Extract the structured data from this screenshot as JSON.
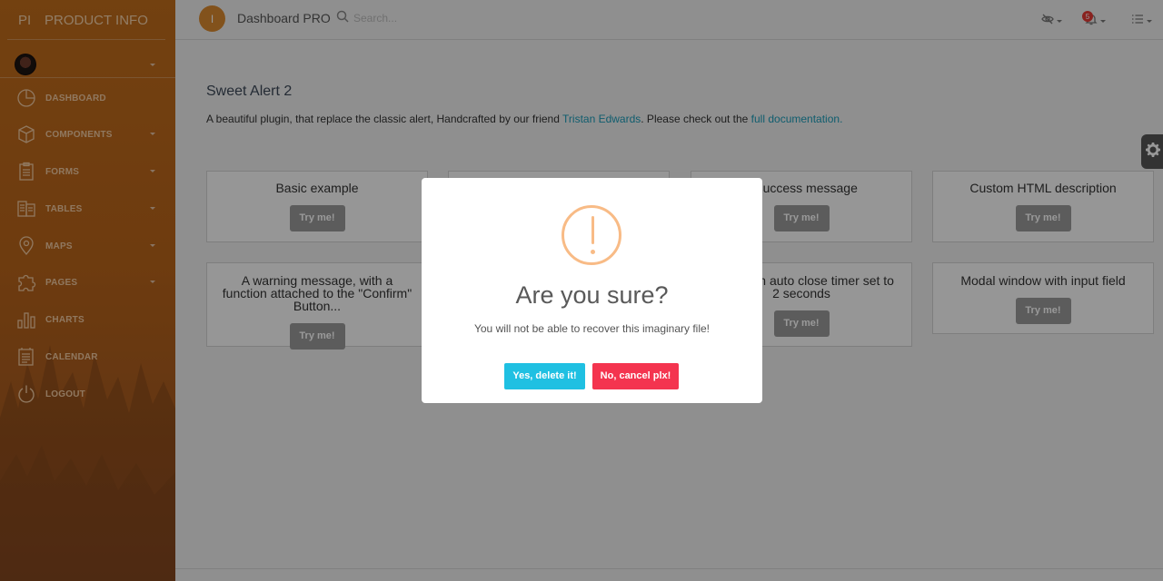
{
  "sidebar": {
    "brand_mini": "PI",
    "brand_name": "PRODUCT INFO",
    "items": [
      {
        "label": "DASHBOARD",
        "icon": "dashboard-icon",
        "has_caret": false
      },
      {
        "label": "COMPONENTS",
        "icon": "cube-icon",
        "has_caret": true
      },
      {
        "label": "FORMS",
        "icon": "clipboard-icon",
        "has_caret": true
      },
      {
        "label": "TABLES",
        "icon": "table-icon",
        "has_caret": true
      },
      {
        "label": "MAPS",
        "icon": "map-pin-icon",
        "has_caret": true
      },
      {
        "label": "PAGES",
        "icon": "puzzle-icon",
        "has_caret": true
      },
      {
        "label": "CHARTS",
        "icon": "bar-chart-icon",
        "has_caret": false
      },
      {
        "label": "CALENDAR",
        "icon": "calendar-icon",
        "has_caret": false
      },
      {
        "label": "LOGOUT",
        "icon": "power-icon",
        "has_caret": false
      }
    ]
  },
  "topbar": {
    "logo_letter": "I",
    "title": "Dashboard PRO",
    "search_placeholder": "Search...",
    "notification_count": "5"
  },
  "main": {
    "heading": "Sweet Alert 2",
    "description_prefix": "A beautiful plugin, that replace the classic alert, Handcrafted by our friend ",
    "description_link1": "Tristan Edwards",
    "description_middle": ". Please check out the ",
    "description_link2": "full documentation.",
    "cards": [
      {
        "title": "Basic example",
        "button": "Try me!"
      },
      {
        "title": "",
        "button": ""
      },
      {
        "title": "A success message",
        "button": "Try me!"
      },
      {
        "title": "Custom HTML description",
        "button": "Try me!"
      },
      {
        "title": "A warning message, with a function attached to the \"Confirm\" Button...",
        "button": "Try me!"
      },
      {
        "title": "",
        "button": ""
      },
      {
        "title": "A title with auto close timer set to 2 seconds",
        "button": "Try me!"
      },
      {
        "title": "Modal window with input field",
        "button": "Try me!"
      }
    ]
  },
  "modal": {
    "icon": "warning-icon",
    "title": "Are you sure?",
    "text": "You will not be able to recover this imaginary file!",
    "confirm_label": "Yes, delete it!",
    "cancel_label": "No, cancel plx!",
    "confirm_color": "#1fc0e2",
    "cancel_color": "#f4344f",
    "warning_color": "#f8bb86"
  },
  "colors": {
    "sidebar_accent": "#c06d1c",
    "link": "#1a9bb8"
  }
}
